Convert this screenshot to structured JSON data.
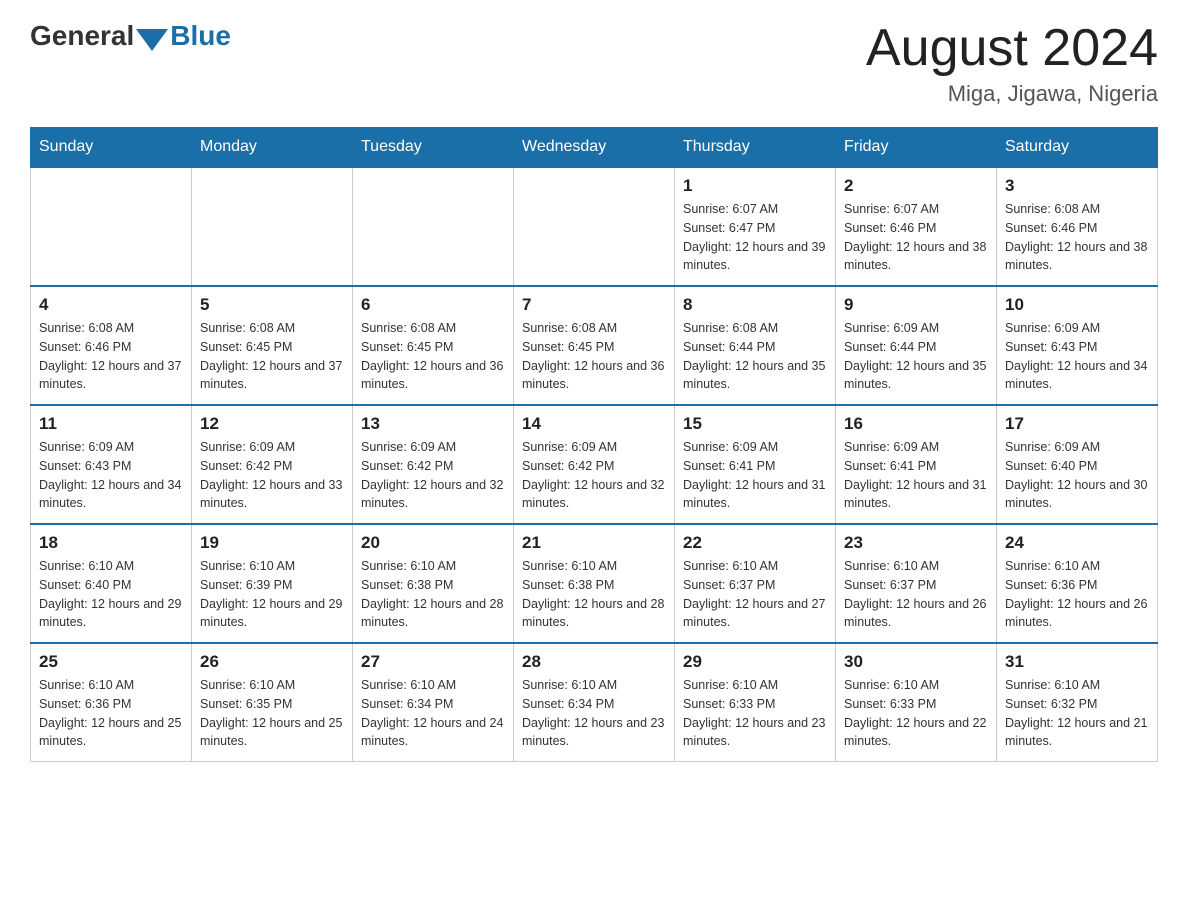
{
  "header": {
    "logo_general": "General",
    "logo_blue": "Blue",
    "month_year": "August 2024",
    "location": "Miga, Jigawa, Nigeria"
  },
  "days_of_week": [
    "Sunday",
    "Monday",
    "Tuesday",
    "Wednesday",
    "Thursday",
    "Friday",
    "Saturday"
  ],
  "weeks": [
    [
      {
        "day": "",
        "info": ""
      },
      {
        "day": "",
        "info": ""
      },
      {
        "day": "",
        "info": ""
      },
      {
        "day": "",
        "info": ""
      },
      {
        "day": "1",
        "info": "Sunrise: 6:07 AM\nSunset: 6:47 PM\nDaylight: 12 hours and 39 minutes."
      },
      {
        "day": "2",
        "info": "Sunrise: 6:07 AM\nSunset: 6:46 PM\nDaylight: 12 hours and 38 minutes."
      },
      {
        "day": "3",
        "info": "Sunrise: 6:08 AM\nSunset: 6:46 PM\nDaylight: 12 hours and 38 minutes."
      }
    ],
    [
      {
        "day": "4",
        "info": "Sunrise: 6:08 AM\nSunset: 6:46 PM\nDaylight: 12 hours and 37 minutes."
      },
      {
        "day": "5",
        "info": "Sunrise: 6:08 AM\nSunset: 6:45 PM\nDaylight: 12 hours and 37 minutes."
      },
      {
        "day": "6",
        "info": "Sunrise: 6:08 AM\nSunset: 6:45 PM\nDaylight: 12 hours and 36 minutes."
      },
      {
        "day": "7",
        "info": "Sunrise: 6:08 AM\nSunset: 6:45 PM\nDaylight: 12 hours and 36 minutes."
      },
      {
        "day": "8",
        "info": "Sunrise: 6:08 AM\nSunset: 6:44 PM\nDaylight: 12 hours and 35 minutes."
      },
      {
        "day": "9",
        "info": "Sunrise: 6:09 AM\nSunset: 6:44 PM\nDaylight: 12 hours and 35 minutes."
      },
      {
        "day": "10",
        "info": "Sunrise: 6:09 AM\nSunset: 6:43 PM\nDaylight: 12 hours and 34 minutes."
      }
    ],
    [
      {
        "day": "11",
        "info": "Sunrise: 6:09 AM\nSunset: 6:43 PM\nDaylight: 12 hours and 34 minutes."
      },
      {
        "day": "12",
        "info": "Sunrise: 6:09 AM\nSunset: 6:42 PM\nDaylight: 12 hours and 33 minutes."
      },
      {
        "day": "13",
        "info": "Sunrise: 6:09 AM\nSunset: 6:42 PM\nDaylight: 12 hours and 32 minutes."
      },
      {
        "day": "14",
        "info": "Sunrise: 6:09 AM\nSunset: 6:42 PM\nDaylight: 12 hours and 32 minutes."
      },
      {
        "day": "15",
        "info": "Sunrise: 6:09 AM\nSunset: 6:41 PM\nDaylight: 12 hours and 31 minutes."
      },
      {
        "day": "16",
        "info": "Sunrise: 6:09 AM\nSunset: 6:41 PM\nDaylight: 12 hours and 31 minutes."
      },
      {
        "day": "17",
        "info": "Sunrise: 6:09 AM\nSunset: 6:40 PM\nDaylight: 12 hours and 30 minutes."
      }
    ],
    [
      {
        "day": "18",
        "info": "Sunrise: 6:10 AM\nSunset: 6:40 PM\nDaylight: 12 hours and 29 minutes."
      },
      {
        "day": "19",
        "info": "Sunrise: 6:10 AM\nSunset: 6:39 PM\nDaylight: 12 hours and 29 minutes."
      },
      {
        "day": "20",
        "info": "Sunrise: 6:10 AM\nSunset: 6:38 PM\nDaylight: 12 hours and 28 minutes."
      },
      {
        "day": "21",
        "info": "Sunrise: 6:10 AM\nSunset: 6:38 PM\nDaylight: 12 hours and 28 minutes."
      },
      {
        "day": "22",
        "info": "Sunrise: 6:10 AM\nSunset: 6:37 PM\nDaylight: 12 hours and 27 minutes."
      },
      {
        "day": "23",
        "info": "Sunrise: 6:10 AM\nSunset: 6:37 PM\nDaylight: 12 hours and 26 minutes."
      },
      {
        "day": "24",
        "info": "Sunrise: 6:10 AM\nSunset: 6:36 PM\nDaylight: 12 hours and 26 minutes."
      }
    ],
    [
      {
        "day": "25",
        "info": "Sunrise: 6:10 AM\nSunset: 6:36 PM\nDaylight: 12 hours and 25 minutes."
      },
      {
        "day": "26",
        "info": "Sunrise: 6:10 AM\nSunset: 6:35 PM\nDaylight: 12 hours and 25 minutes."
      },
      {
        "day": "27",
        "info": "Sunrise: 6:10 AM\nSunset: 6:34 PM\nDaylight: 12 hours and 24 minutes."
      },
      {
        "day": "28",
        "info": "Sunrise: 6:10 AM\nSunset: 6:34 PM\nDaylight: 12 hours and 23 minutes."
      },
      {
        "day": "29",
        "info": "Sunrise: 6:10 AM\nSunset: 6:33 PM\nDaylight: 12 hours and 23 minutes."
      },
      {
        "day": "30",
        "info": "Sunrise: 6:10 AM\nSunset: 6:33 PM\nDaylight: 12 hours and 22 minutes."
      },
      {
        "day": "31",
        "info": "Sunrise: 6:10 AM\nSunset: 6:32 PM\nDaylight: 12 hours and 21 minutes."
      }
    ]
  ]
}
